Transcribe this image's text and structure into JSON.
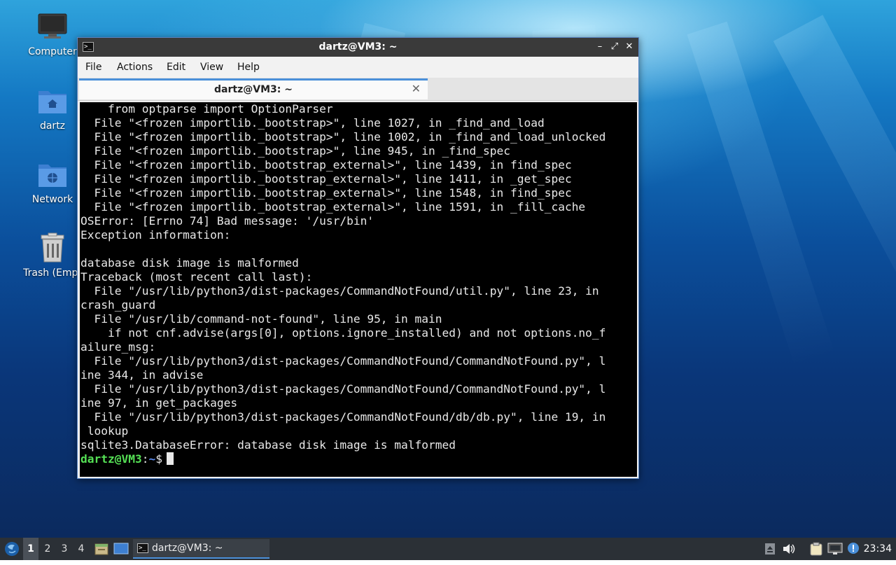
{
  "desktop": {
    "icons": [
      {
        "label": "Computer",
        "icon": "computer-icon"
      },
      {
        "label": "dartz",
        "icon": "home-folder-icon"
      },
      {
        "label": "Network",
        "icon": "network-folder-icon"
      },
      {
        "label": "Trash (Empt",
        "icon": "trash-icon"
      }
    ]
  },
  "window": {
    "title": "dartz@VM3: ~",
    "app_icon_text": ">_",
    "controls": {
      "minimize": "–",
      "maximize": "⤢",
      "close": "✕"
    },
    "menu": [
      "File",
      "Actions",
      "Edit",
      "View",
      "Help"
    ],
    "tab": {
      "label": "dartz@VM3: ~",
      "close": "✕"
    }
  },
  "terminal": {
    "lines": [
      "    from optparse import OptionParser",
      "  File \"<frozen importlib._bootstrap>\", line 1027, in _find_and_load",
      "  File \"<frozen importlib._bootstrap>\", line 1002, in _find_and_load_unlocked",
      "  File \"<frozen importlib._bootstrap>\", line 945, in _find_spec",
      "  File \"<frozen importlib._bootstrap_external>\", line 1439, in find_spec",
      "  File \"<frozen importlib._bootstrap_external>\", line 1411, in _get_spec",
      "  File \"<frozen importlib._bootstrap_external>\", line 1548, in find_spec",
      "  File \"<frozen importlib._bootstrap_external>\", line 1591, in _fill_cache",
      "OSError: [Errno 74] Bad message: '/usr/bin'",
      "Exception information:",
      "",
      "database disk image is malformed",
      "Traceback (most recent call last):",
      "  File \"/usr/lib/python3/dist-packages/CommandNotFound/util.py\", line 23, in",
      "crash_guard",
      "  File \"/usr/lib/command-not-found\", line 95, in main",
      "    if not cnf.advise(args[0], options.ignore_installed) and not options.no_f",
      "ailure_msg:",
      "  File \"/usr/lib/python3/dist-packages/CommandNotFound/CommandNotFound.py\", l",
      "ine 344, in advise",
      "  File \"/usr/lib/python3/dist-packages/CommandNotFound/CommandNotFound.py\", l",
      "ine 97, in get_packages",
      "  File \"/usr/lib/python3/dist-packages/CommandNotFound/db/db.py\", line 19, in",
      " lookup",
      "sqlite3.DatabaseError: database disk image is malformed"
    ],
    "prompt": {
      "user_host": "dartz@VM3",
      "sep": ":",
      "path": "~",
      "symbol": "$"
    }
  },
  "taskbar": {
    "workspaces": [
      "1",
      "2",
      "3",
      "4"
    ],
    "active_workspace": "1",
    "task_label": "dartz@VM3: ~",
    "task_icon_text": ">_",
    "clock": "23:34"
  },
  "colors": {
    "prompt_user": "#55e055",
    "prompt_path": "#5c8cf0",
    "accent": "#4a90d9"
  }
}
